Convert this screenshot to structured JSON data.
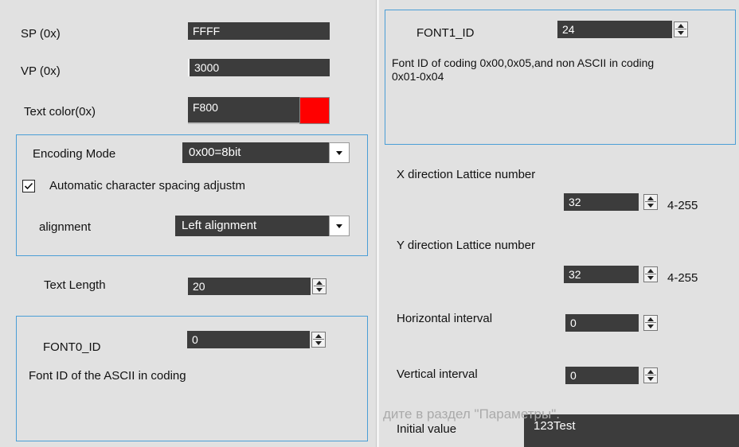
{
  "left": {
    "sp": {
      "label": "SP (0x)",
      "value": "FFFF"
    },
    "vp": {
      "label": "VP (0x)",
      "value": "3000"
    },
    "text_color": {
      "label": "Text color(0x)",
      "value": "F800",
      "swatch": "#ff0000"
    },
    "encoding": {
      "label": "Encoding Mode",
      "value": "0x00=8bit"
    },
    "auto_spacing": {
      "label": "Automatic character spacing adjustm",
      "checked": true
    },
    "alignment": {
      "label": "alignment",
      "value": "Left alignment"
    },
    "text_length": {
      "label": "Text Length",
      "value": "20"
    },
    "font0": {
      "label": "FONT0_ID",
      "value": "0",
      "description": "Font ID of the ASCII in coding"
    }
  },
  "right": {
    "font1": {
      "label": "FONT1_ID",
      "value": "24",
      "description": "Font ID of coding 0x00,0x05,and non ASCII in coding 0x01-0x04"
    },
    "x_lattice": {
      "label": "X direction Lattice number",
      "value": "32",
      "range": "4-255"
    },
    "y_lattice": {
      "label": "Y direction Lattice number",
      "value": "32",
      "range": "4-255"
    },
    "h_interval": {
      "label": "Horizontal interval",
      "value": "0"
    },
    "v_interval": {
      "label": "Vertical interval",
      "value": "0"
    },
    "initial_value": {
      "label": "Initial value",
      "value": "123Test"
    }
  },
  "overlay": {
    "watermark": "дите в раздел \"Параметры\"."
  },
  "colors": {
    "field_bg": "#3c3c3c",
    "group_border": "#4a9ed6",
    "panel_bg": "#e1e1e1"
  }
}
